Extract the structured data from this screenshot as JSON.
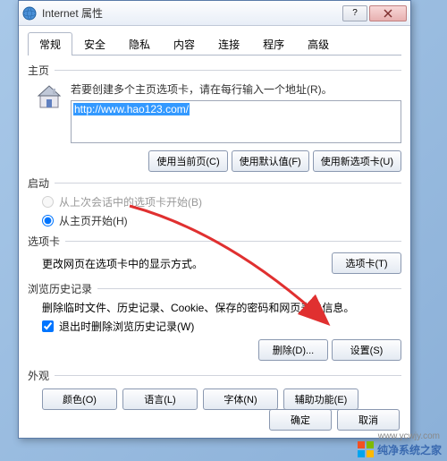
{
  "window": {
    "title": "Internet 属性"
  },
  "tabs": [
    "常规",
    "安全",
    "隐私",
    "内容",
    "连接",
    "程序",
    "高级"
  ],
  "homepage": {
    "label": "主页",
    "hint": "若要创建多个主页选项卡，请在每行输入一个地址(R)。",
    "url": "http://www.hao123.com/",
    "btn_current": "使用当前页(C)",
    "btn_default": "使用默认值(F)",
    "btn_newtab": "使用新选项卡(U)"
  },
  "startup": {
    "label": "启动",
    "radio_last": "从上次会话中的选项卡开始(B)",
    "radio_home": "从主页开始(H)"
  },
  "tabsection": {
    "label": "选项卡",
    "text": "更改网页在选项卡中的显示方式。",
    "btn": "选项卡(T)"
  },
  "history": {
    "label": "浏览历史记录",
    "text": "删除临时文件、历史记录、Cookie、保存的密码和网页表单信息。",
    "checkbox": "退出时删除浏览历史记录(W)",
    "btn_delete": "删除(D)...",
    "btn_settings": "设置(S)"
  },
  "appearance": {
    "label": "外观",
    "btn_color": "颜色(O)",
    "btn_lang": "语言(L)",
    "btn_font": "字体(N)",
    "btn_access": "辅助功能(E)"
  },
  "footer": {
    "ok": "确定",
    "cancel": "取消"
  },
  "watermark": {
    "text": "纯净系统之家",
    "url": "www.ycwjy.com"
  }
}
